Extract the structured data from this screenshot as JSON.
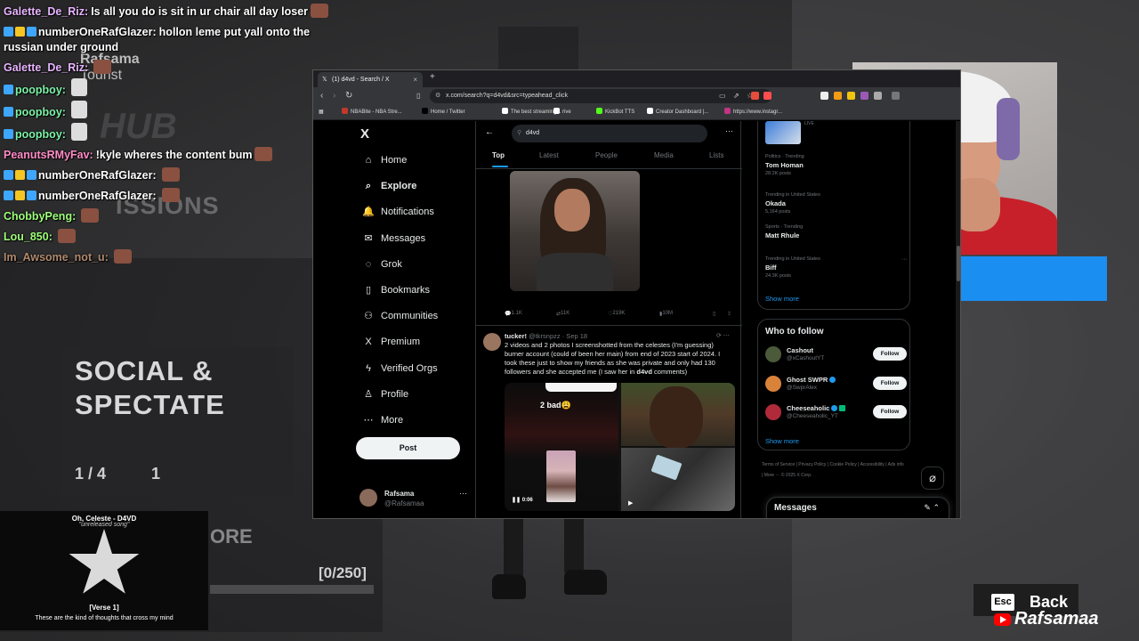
{
  "chat": [
    {
      "user": "Galette_De_Riz:",
      "color": "#e8b4ff",
      "badges": [],
      "msg": "Is all you do is sit in ur chair all day loser",
      "emote": true,
      "wrap": false
    },
    {
      "user": "numberOneRafGlazer:",
      "color": "#ffffff",
      "badges": [
        "#3ea6ff",
        "#f3c623",
        "#3ea6ff"
      ],
      "msg": "hollon leme put yall onto the russian under ground",
      "emote": false,
      "wrap": true
    },
    {
      "user": "Galette_De_Riz:",
      "color": "#e8b4ff",
      "badges": [],
      "msg": "",
      "emote": true,
      "wrap": false
    },
    {
      "user": "poopboy:",
      "color": "#7cf2a6",
      "badges": [
        "#3ea6ff"
      ],
      "msg": "",
      "emote": "blank",
      "wrap": false
    },
    {
      "user": "poopboy:",
      "color": "#7cf2a6",
      "badges": [
        "#3ea6ff"
      ],
      "msg": "",
      "emote": "blank",
      "wrap": false
    },
    {
      "user": "poopboy:",
      "color": "#7cf2a6",
      "badges": [
        "#3ea6ff"
      ],
      "msg": "",
      "emote": "blank",
      "wrap": false
    },
    {
      "user": "PeanutsRMyFav:",
      "color": "#ff8cc6",
      "badges": [],
      "msg": "!kyle wheres the content bum",
      "emote": true,
      "wrap": false
    },
    {
      "user": "numberOneRafGlazer:",
      "color": "#ffffff",
      "badges": [
        "#3ea6ff",
        "#f3c623",
        "#3ea6ff"
      ],
      "msg": "",
      "emote": true,
      "wrap": false
    },
    {
      "user": "numberOneRafGlazer:",
      "color": "#ffffff",
      "badges": [
        "#3ea6ff",
        "#f3c623",
        "#3ea6ff"
      ],
      "msg": "",
      "emote": true,
      "wrap": false
    },
    {
      "user": "ChobbyPeng:",
      "color": "#9eff7a",
      "badges": [],
      "msg": "",
      "emote": true,
      "wrap": false
    },
    {
      "user": "Lou_850:",
      "color": "#9eff7a",
      "badges": [],
      "msg": "",
      "emote": true,
      "wrap": false
    },
    {
      "user": "Im_Awsome_not_u:",
      "color": "#b08a6e",
      "badges": [],
      "msg": "",
      "emote": true,
      "wrap": false
    }
  ],
  "game": {
    "player_name": "Rafsama",
    "player_rank": "Tourist",
    "hub": "HUB",
    "missions": "ISSIONS",
    "panel_title": "SOCIAL &\nSPECTATE",
    "panel_counter": "1 / 4",
    "panel_counter2": "1",
    "more": "ORE",
    "char_count": "[0/250]",
    "esc_key": "Esc",
    "esc_label": "Back",
    "watermark": "Rafsamaa"
  },
  "music": {
    "top": "Oh, Celeste - D4VD",
    "title": "Oh, Celeste - D4VD",
    "sub": "\"unreleased song\"",
    "verse": "[Verse 1]",
    "lyric": "These are the kind of thoughts that cross my mind"
  },
  "browser": {
    "tab_title": "(1) d4vd - Search / X",
    "tab_close": "×",
    "new_tab": "+",
    "url": "x.com/search?q=d4vd&src=typeahead_click",
    "bookmarks": [
      {
        "label": "NBABite - NBA Stre...",
        "color": "#c0392b"
      },
      {
        "label": "Home / Twitter",
        "color": "#000000"
      },
      {
        "label": "The best streaming...",
        "color": "#ffffff"
      },
      {
        "label": "rive",
        "color": "#ffffff"
      },
      {
        "label": "KickBot TTS",
        "color": "#53fc18"
      },
      {
        "label": "Creator Dashboard |...",
        "color": "#ffffff"
      },
      {
        "label": "https://www.instagr...",
        "color": "#c13584"
      }
    ]
  },
  "x": {
    "logo": "X",
    "nav": [
      {
        "label": "Home",
        "icon": "⌂",
        "name": "home"
      },
      {
        "label": "Explore",
        "icon": "⌕",
        "name": "explore"
      },
      {
        "label": "Notifications",
        "icon": "🔔",
        "name": "notifications"
      },
      {
        "label": "Messages",
        "icon": "✉",
        "name": "messages"
      },
      {
        "label": "Grok",
        "icon": "◌",
        "name": "grok"
      },
      {
        "label": "Bookmarks",
        "icon": "▯",
        "name": "bookmarks"
      },
      {
        "label": "Communities",
        "icon": "⚇",
        "name": "communities"
      },
      {
        "label": "Premium",
        "icon": "X",
        "name": "premium"
      },
      {
        "label": "Verified Orgs",
        "icon": "ϟ",
        "name": "verified-orgs"
      },
      {
        "label": "Profile",
        "icon": "♙",
        "name": "profile"
      },
      {
        "label": "More",
        "icon": "⋯",
        "name": "more"
      }
    ],
    "post_label": "Post",
    "account": {
      "name": "Rafsama",
      "handle": "@Rafsamaa",
      "more": "···"
    },
    "search": {
      "value": "d4vd",
      "more": "···"
    },
    "tabs": [
      "Top",
      "Latest",
      "People",
      "Media",
      "Lists"
    ],
    "tweet1_actions": {
      "replies": "1.1K",
      "reposts": "11K",
      "likes": "219K",
      "views": "10M"
    },
    "tweet2": {
      "name": "tucker!",
      "handle": "@tkrsnpzz · Sep 18",
      "text_before": "2 videos and 2 photos I screenshotted from the celestes (I'm guessing) burner account (could of been her main) from end of 2023 start of 2024. I took these just to show my friends as she was private and only had 130 followers and she accepted me (I saw her in ",
      "text_mention": "d4vd",
      "text_after": " comments)",
      "overlay_text": "2 bad😩",
      "duration": "0:06"
    },
    "live_label": "LIVE",
    "trends": [
      {
        "ctx": "Politics · Trending",
        "name": "Tom Homan",
        "count": "28.2K posts"
      },
      {
        "ctx": "Trending in United States",
        "name": "Okada",
        "count": "5,164 posts"
      },
      {
        "ctx": "Sports · Trending",
        "name": "Matt Rhule",
        "count": ""
      },
      {
        "ctx": "Trending in United States",
        "name": "Biff",
        "count": "24.3K posts"
      }
    ],
    "show_more": "Show more",
    "who_to_follow": "Who to follow",
    "follows": [
      {
        "name": "Cashout",
        "handle": "@xCashoutYT",
        "verified": "",
        "avatar": "#4a5a3a"
      },
      {
        "name": "Ghost SWPR",
        "handle": "@SwprAlex",
        "verified": "blue",
        "avatar": "#d9823a"
      },
      {
        "name": "Cheeseaholic",
        "handle": "@Cheeseaholic_YT",
        "verified": "both",
        "avatar": "#b02a3a"
      }
    ],
    "follow_label": "Follow",
    "footer": "Terms of Service  |  Privacy Policy  |  Cookie Policy  |  Accessibility  |  Ads info  |  More ···  © 2025 X Corp.",
    "messages_title": "Messages"
  }
}
